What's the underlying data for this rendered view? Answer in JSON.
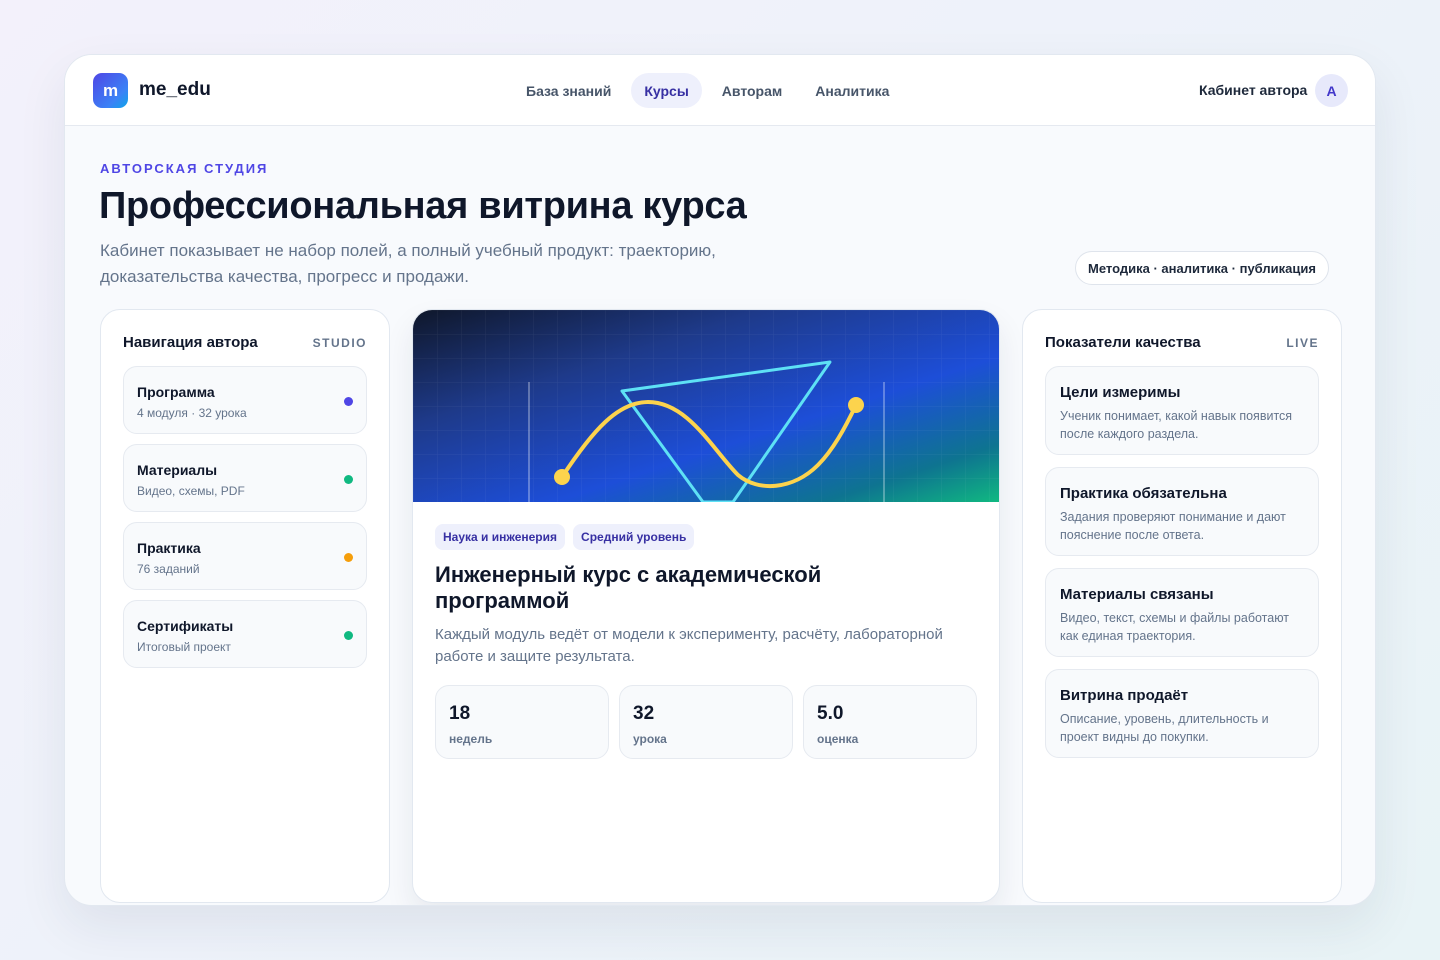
{
  "header": {
    "logo_letter": "m",
    "logo_text": "me_edu",
    "nav": [
      {
        "label": "База знаний"
      },
      {
        "label": "Курсы",
        "active": true
      },
      {
        "label": "Авторам"
      },
      {
        "label": "Аналитика"
      }
    ],
    "cabinet_label": "Кабинет автора",
    "avatar_letter": "A"
  },
  "hero_section": {
    "eyebrow": "АВТОРСКАЯ СТУДИЯ",
    "title": "Профессиональная витрина курса",
    "subtitle": "Кабинет показывает не набор полей, а полный учебный продукт: траекторию, доказательства качества, прогресс и продажи.",
    "chip": "Методика · аналитика · публикация"
  },
  "author_nav": {
    "title": "Навигация автора",
    "tag": "STUDIO",
    "items": [
      {
        "title": "Программа",
        "sub": "4 модуля · 32 урока",
        "dot_color": "#4f46e5"
      },
      {
        "title": "Материалы",
        "sub": "Видео, схемы, PDF",
        "dot_color": "#10b981"
      },
      {
        "title": "Практика",
        "sub": "76 заданий",
        "dot_color": "#f59e0b"
      },
      {
        "title": "Сертификаты",
        "sub": "Итоговый проект",
        "dot_color": "#10b981"
      }
    ]
  },
  "course": {
    "badges": [
      "Наука и инженерия",
      "Средний уровень"
    ],
    "title": "Инженерный курс с академической программой",
    "description": "Каждый модуль ведёт от модели к эксперименту, расчёту, лабораторной работе и защите результата.",
    "stats": [
      {
        "value": "18",
        "label": "недель"
      },
      {
        "value": "32",
        "label": "урока"
      },
      {
        "value": "5.0",
        "label": "оценка"
      }
    ]
  },
  "quality": {
    "title": "Показатели качества",
    "tag": "LIVE",
    "items": [
      {
        "title": "Цели измеримы",
        "desc": "Ученик понимает, какой навык появится после каждого раздела."
      },
      {
        "title": "Практика обязательна",
        "desc": "Задания проверяют понимание и дают пояснение после ответа."
      },
      {
        "title": "Материалы связаны",
        "desc": "Видео, текст, схемы и файлы работают как единая траектория."
      },
      {
        "title": "Витрина продаёт",
        "desc": "Описание, уровень, длительность и проект видны до покупки."
      }
    ]
  }
}
